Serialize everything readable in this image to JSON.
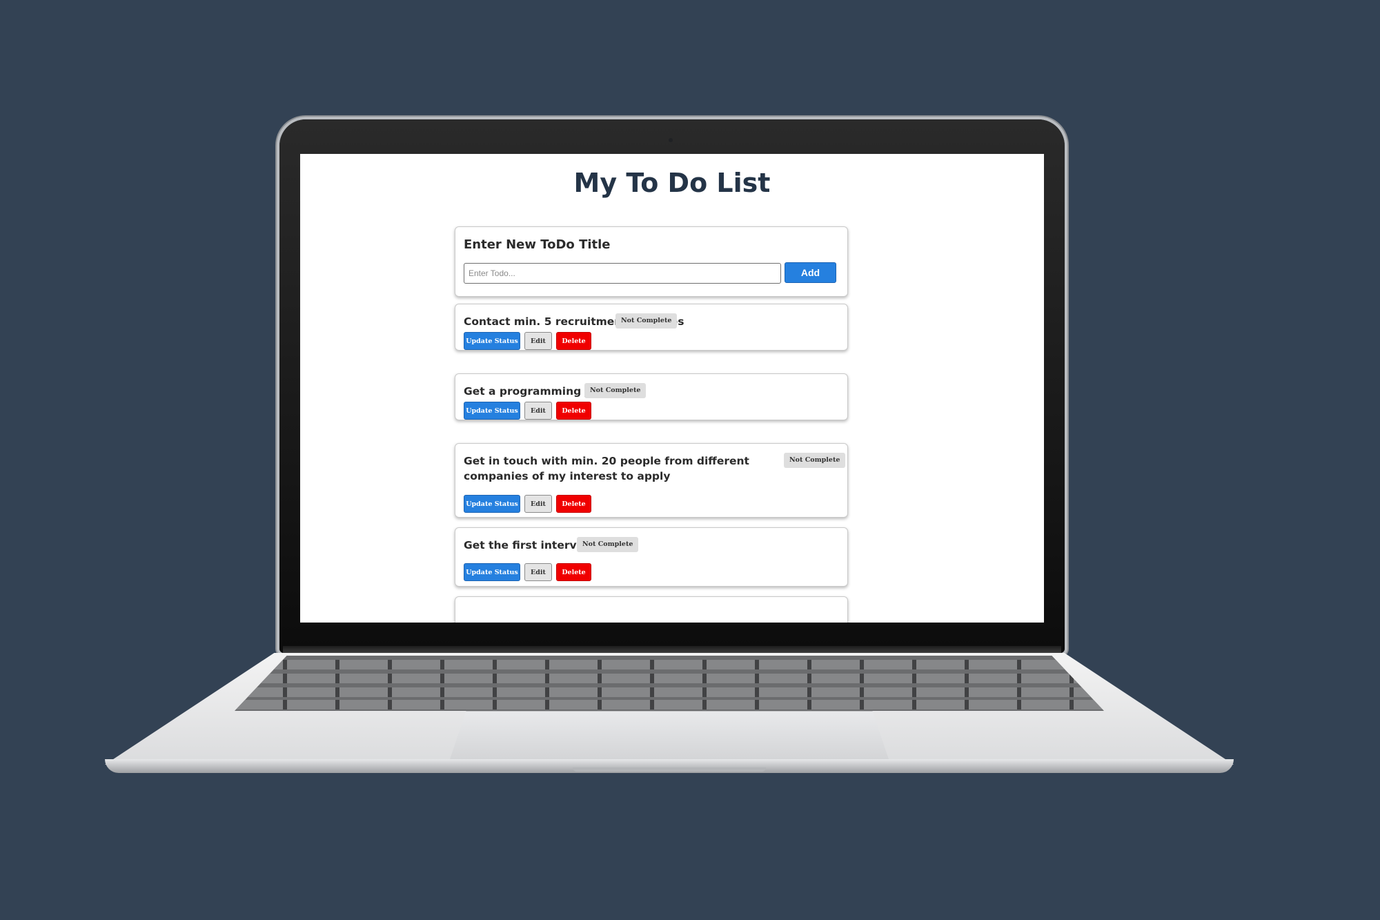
{
  "app": {
    "title": "My To Do List"
  },
  "new_todo": {
    "label": "Enter New ToDo Title",
    "input_value": "",
    "input_placeholder": "Enter Todo...",
    "add_label": "Add"
  },
  "todos": [
    {
      "title": "Contact min. 5 recruitment agencies",
      "status": "Not Complete"
    },
    {
      "title": "Get a programming job",
      "status": "Not Complete"
    },
    {
      "title": "Get in touch with min. 20 people from different companies of my interest to apply",
      "status": "Not Complete"
    },
    {
      "title": "Get the first interview",
      "status": "Not Complete"
    }
  ],
  "actions": {
    "update_label": "Update Status",
    "edit_label": "Edit",
    "delete_label": "Delete"
  },
  "colors": {
    "background": "#334254",
    "primary": "#2580df",
    "danger": "#f00000",
    "badge": "#dedede",
    "title": "#243447"
  }
}
